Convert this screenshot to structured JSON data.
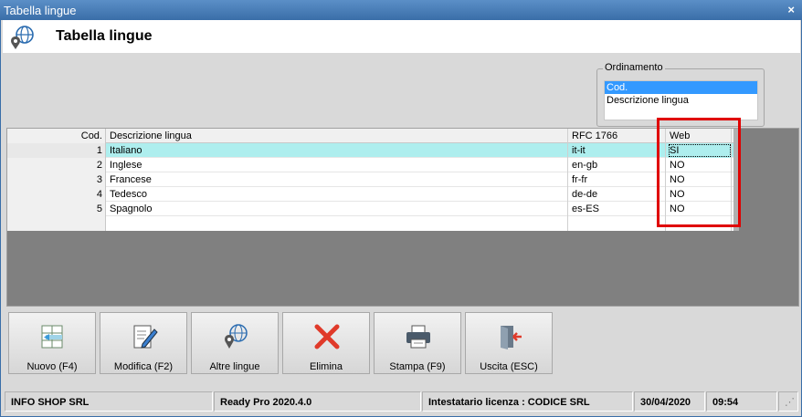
{
  "window": {
    "title": "Tabella lingue",
    "close": "×"
  },
  "header": {
    "title": "Tabella lingue"
  },
  "ordinamento": {
    "legend": "Ordinamento",
    "options": [
      "Cod.",
      "Descrizione lingua"
    ],
    "selected": "Cod."
  },
  "table": {
    "columns": [
      "Cod.",
      "Descrizione lingua",
      "RFC 1766",
      "Web"
    ],
    "rows": [
      {
        "cod": "1",
        "descrizione": "Italiano",
        "rfc": "it-it",
        "web": "SI"
      },
      {
        "cod": "2",
        "descrizione": "Inglese",
        "rfc": "en-gb",
        "web": "NO"
      },
      {
        "cod": "3",
        "descrizione": "Francese",
        "rfc": "fr-fr",
        "web": "NO"
      },
      {
        "cod": "4",
        "descrizione": "Tedesco",
        "rfc": "de-de",
        "web": "NO"
      },
      {
        "cod": "5",
        "descrizione": "Spagnolo",
        "rfc": "es-ES",
        "web": "NO"
      }
    ]
  },
  "toolbar": {
    "nuovo": "Nuovo (F4)",
    "modifica": "Modifica (F2)",
    "altre_lingue": "Altre lingue",
    "elimina": "Elimina",
    "stampa": "Stampa (F9)",
    "uscita": "Uscita (ESC)"
  },
  "status": {
    "company": "INFO SHOP SRL",
    "version": "Ready Pro 2020.4.0",
    "license": "Intestatario licenza : CODICE SRL",
    "date": "30/04/2020",
    "time": "09:54"
  }
}
